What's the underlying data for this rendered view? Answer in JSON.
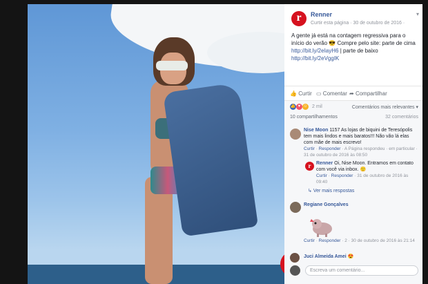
{
  "post": {
    "page_name": "Renner",
    "page_sub": "Curtir esta página · 30 de outubro de 2016 ·",
    "text_1": "A gente já está na contagem regressiva para o início do verão",
    "text_2": " Compre pelo site: parte de cima",
    "link_1": "http://bit.ly/2eIayH6",
    "text_3": " | parte de baixo",
    "link_2": "http://bit.ly/2eVggIK",
    "photo_logo_letter": "r"
  },
  "actions": {
    "like": "Curtir",
    "comment": "Comentar",
    "share": "Compartilhar"
  },
  "reactions": {
    "count": "2 mil",
    "sort": "Comentários mais relevantes ▾",
    "shares": "10 compartilhamentos",
    "comments_count": "32 comentários"
  },
  "comments": [
    {
      "name": "Nise Moon",
      "text": " 1157 As lojas de biquini de Teresópolis tem mais lindos e mais baratos!!! Não vão lá elas com mãe de mais escrevo!",
      "meta_like": "Curtir",
      "meta_reply": "Responder",
      "meta_rest": " · A Página respondeu · em particular · 31 de outubro de 2016 às 08:50"
    },
    {
      "name": "Renner",
      "text": " Oi, Nise Moon. Entramos em contato com você via inbox.",
      "meta_like": "Curtir",
      "meta_reply": "Responder",
      "meta_rest": " · 31 de outubro de 2016 às 09:40"
    },
    {
      "more_replies": "Ver mais respostas"
    },
    {
      "name": "Regiane Gonçalves",
      "meta_like": "Curtir",
      "meta_reply": "Responder",
      "meta_rest": " · 2 · 30 de outubro de 2016 às 21:14"
    },
    {
      "name": "Juci Almeida Amei"
    }
  ],
  "reply_placeholder": "Escreva um comentário...",
  "colors": {
    "brand": "#d6121f",
    "link": "#365899",
    "like_blue": "#4267b2"
  }
}
